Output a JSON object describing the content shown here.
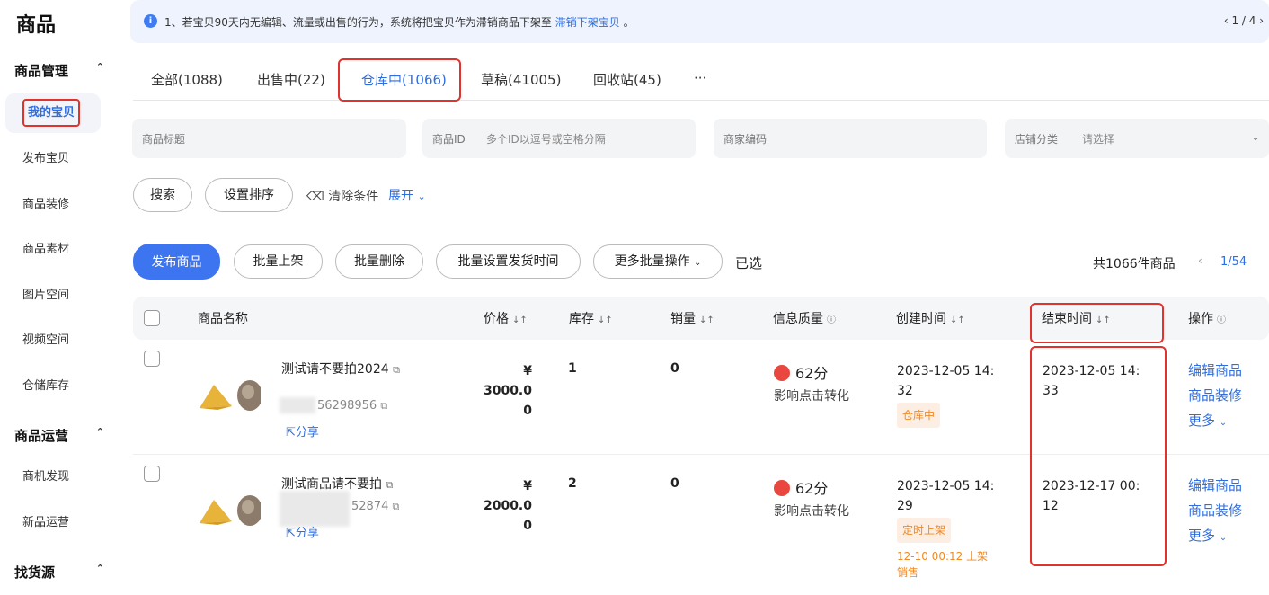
{
  "sidebar": {
    "brand": "商品",
    "groups": [
      {
        "label": "商品管理",
        "items": [
          "我的宝贝",
          "发布宝贝",
          "商品装修",
          "商品素材",
          "图片空间",
          "视频空间",
          "仓储库存"
        ]
      },
      {
        "label": "商品运营",
        "items": [
          "商机发现",
          "新品运营"
        ]
      },
      {
        "label": "找货源",
        "items": []
      }
    ],
    "active_item": "我的宝贝"
  },
  "notice": {
    "text": "1、若宝贝90天内无编辑、流量或出售的行为，系统将把宝贝作为滞销商品下架至",
    "link": "滞销下架宝贝",
    "suffix": "。",
    "pager": "‹ 1 / 4 ›"
  },
  "tabs": [
    {
      "label": "全部(1088)"
    },
    {
      "label": "出售中(22)"
    },
    {
      "label": "仓库中(1066)",
      "active": true
    },
    {
      "label": "草稿(41005)"
    },
    {
      "label": "回收站(45)"
    },
    {
      "label": "···"
    }
  ],
  "filters": {
    "title_label": "商品标题",
    "id_label": "商品ID",
    "id_placeholder": "多个ID以逗号或空格分隔",
    "merchant_code_label": "商家编码",
    "category_label": "店铺分类",
    "category_placeholder": "请选择"
  },
  "actions": {
    "search": "搜索",
    "set_sort": "设置排序",
    "clear": "清除条件",
    "expand": "展开"
  },
  "batch": {
    "publish": "发布商品",
    "batch_list": "批量上架",
    "batch_delete": "批量删除",
    "batch_ship_time": "批量设置发货时间",
    "more_batch": "更多批量操作",
    "selected": "已选",
    "total": "共1066件商品",
    "page": "1/54"
  },
  "table": {
    "headers": {
      "name": "商品名称",
      "price": "价格",
      "stock": "库存",
      "sales": "销量",
      "quality": "信息质量",
      "created": "创建时间",
      "end": "结束时间",
      "ops": "操作"
    },
    "rows": [
      {
        "title": "测试请不要拍2024",
        "id": "56298956",
        "share": "分享",
        "price_line1": "¥ 3000.0",
        "price_line2": "0",
        "stock": "1",
        "sales": "0",
        "score": "62分",
        "quality_note": "影响点击转化",
        "created_line1": "2023-12-05 14:",
        "created_line2": "32",
        "status": "仓库中",
        "end_line1": "2023-12-05 14:",
        "end_line2": "33",
        "op_edit": "编辑商品",
        "op_decorate": "商品装修",
        "op_more": "更多"
      },
      {
        "title": "测试商品请不要拍",
        "id": "52874",
        "share": "分享",
        "price_line1": "¥ 2000.0",
        "price_line2": "0",
        "stock": "2",
        "sales": "0",
        "score": "62分",
        "quality_note": "影响点击转化",
        "created_line1": "2023-12-05 14:",
        "created_line2": "29",
        "status": "定时上架",
        "schedule_line1": "12-10 00:12 上架",
        "schedule_line2": "销售",
        "end_line1": "2023-12-17 00:",
        "end_line2": "12",
        "op_edit": "编辑商品",
        "op_decorate": "商品装修",
        "op_more": "更多"
      }
    ]
  },
  "colors": {
    "accent": "#2f6ee0",
    "primary_button": "#3d74ef",
    "highlight_box": "#e0332e",
    "warn": "#e8463e",
    "status_orange": "#f08a24"
  }
}
